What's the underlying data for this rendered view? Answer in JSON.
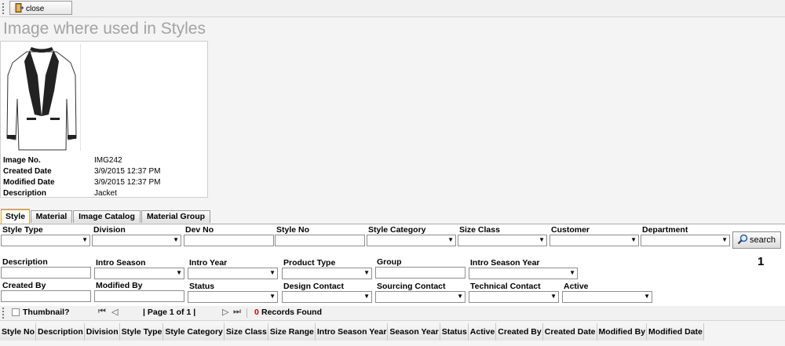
{
  "toolbar": {
    "close_label": "close",
    "close_icon": "exit-door-icon"
  },
  "page_title": "Image where used in Styles",
  "image_info": {
    "rows": [
      {
        "key": "Image No.",
        "value": "IMG242"
      },
      {
        "key": "Created Date",
        "value": "3/9/2015 12:37 PM"
      },
      {
        "key": "Modified Date",
        "value": "3/9/2015 12:37 PM"
      },
      {
        "key": "Description",
        "value": "Jacket"
      }
    ]
  },
  "tabs": [
    "Style",
    "Material",
    "Image Catalog",
    "Material Group"
  ],
  "form": {
    "labels": [
      "Style Type",
      "Division",
      "Dev No",
      "Style No",
      "Style Category",
      "Size Class",
      "Customer",
      "Department",
      "Description",
      "Intro Season",
      "Intro Year",
      "Product Type",
      "Group",
      "Intro Season Year",
      "Created By",
      "Modified By",
      "Status",
      "Design Contact",
      "Sourcing Contact",
      "Technical Contact",
      "Active"
    ],
    "search_label": "search"
  },
  "result_badge": "1",
  "pager": {
    "thumbnail_label": "Thumbnail?",
    "page_label": "| Page 1 of 1 |",
    "records_count": "0",
    "records_label": "Records Found"
  },
  "grid_columns": [
    "Style No",
    "Description",
    "Division",
    "Style Type",
    "Style Category",
    "Size Class",
    "Size Range",
    "Intro Season Year",
    "Season Year",
    "Status",
    "Active",
    "Created By",
    "Created Date",
    "Modified By",
    "Modified Date"
  ],
  "colors": {
    "title": "#a3a3a3",
    "active_tab": "#f0a030",
    "records_count": "#d40000"
  }
}
